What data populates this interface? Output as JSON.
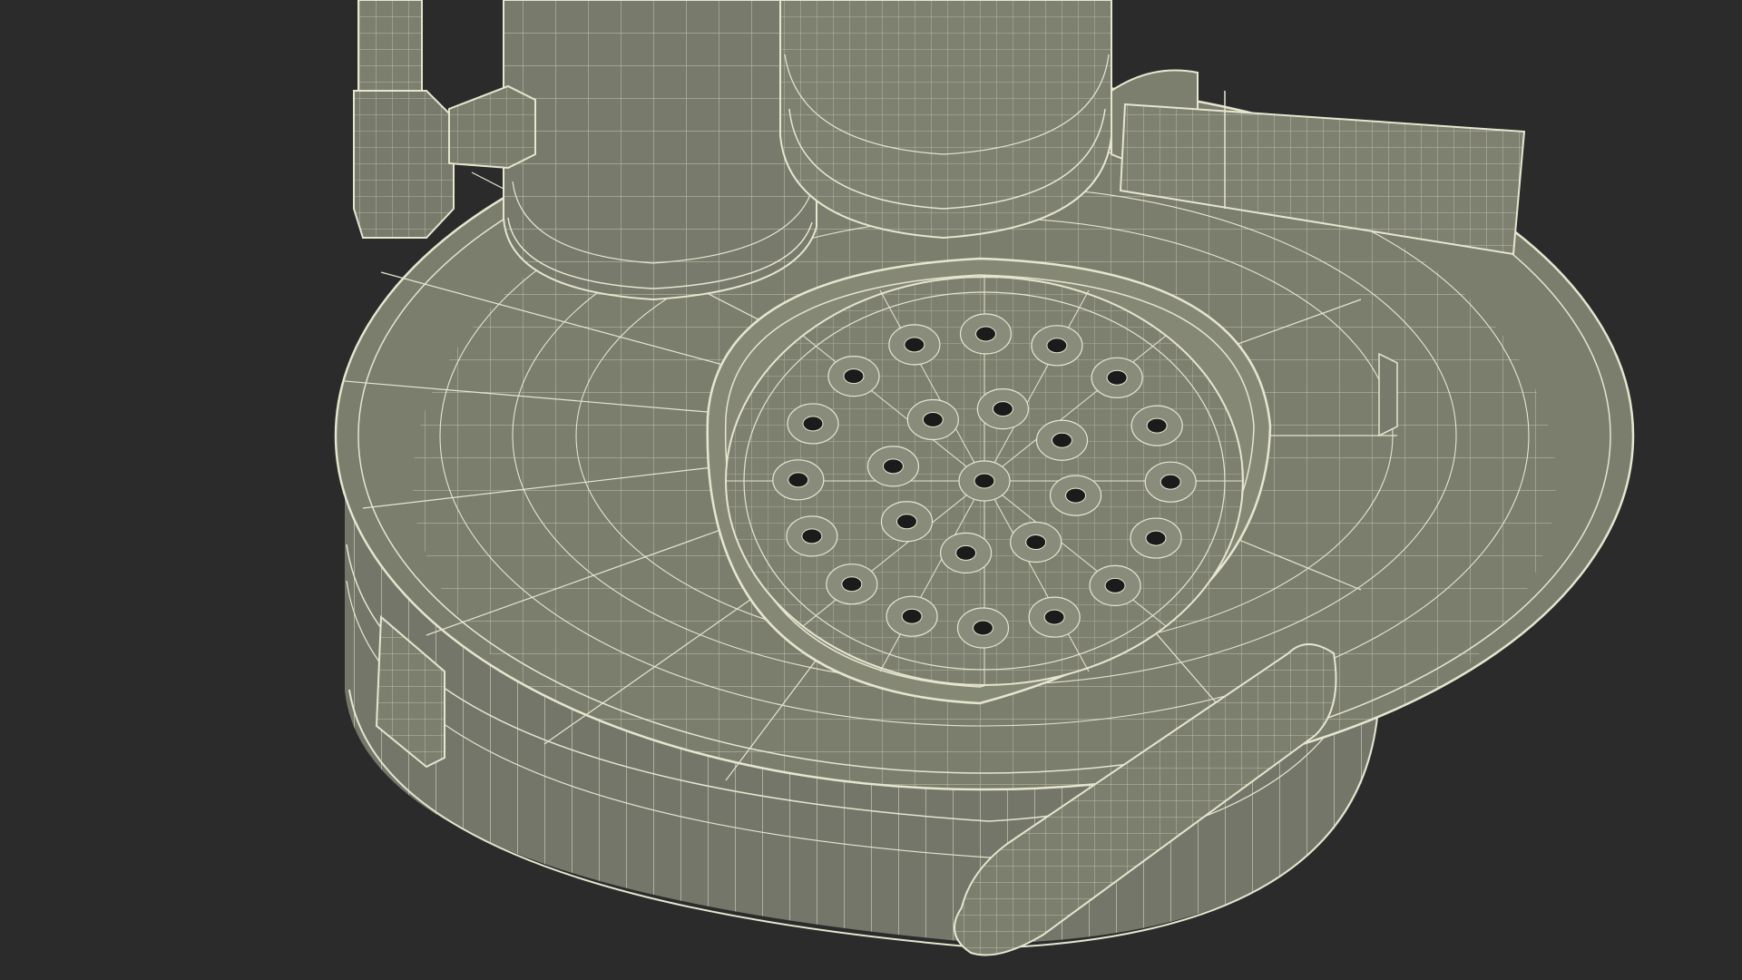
{
  "scene": {
    "subject": "wireframe-render-submersible-pump-base",
    "colors": {
      "background": "#2b2b2c",
      "surface": "#7b7d6d",
      "surface_dark": "#6b6d5e",
      "surface_light": "#8a8c7b",
      "wire": "#e6e6cf",
      "hole": "#1b1b1b"
    },
    "holes": {
      "rings": [
        {
          "radius_fraction": 0.0,
          "count": 1
        },
        {
          "radius_fraction": 0.36,
          "count": 8
        },
        {
          "radius_fraction": 0.72,
          "count": 16
        }
      ]
    }
  }
}
